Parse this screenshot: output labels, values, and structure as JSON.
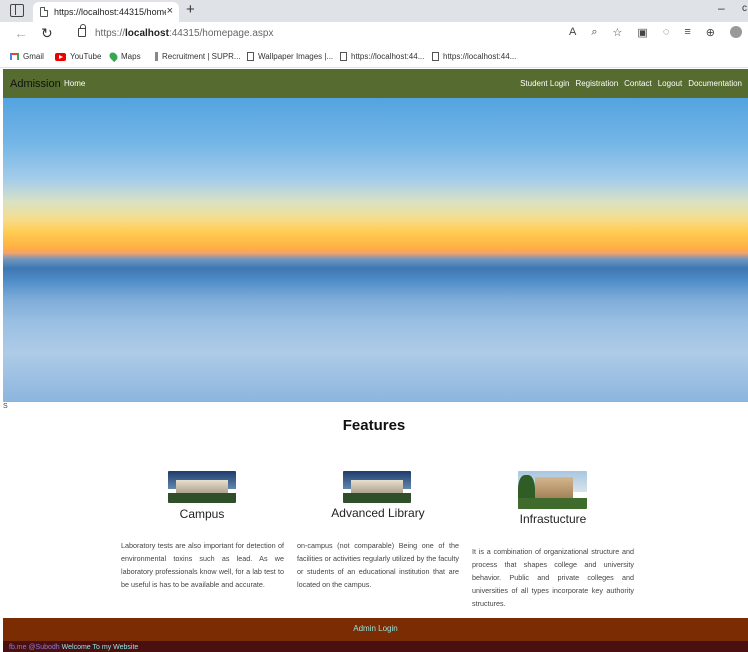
{
  "browser": {
    "tab_title": "https://localhost:44315/homepage.aspx",
    "tab_close": "×",
    "new_tab": "+",
    "window_minimize": "–",
    "url_prefix": "https://",
    "url_host": "localhost",
    "url_rest": ":44315/homepage.aspx",
    "back_icon": "←",
    "reload_icon": "↻",
    "bookmarks": [
      {
        "label": "Gmail",
        "icon": "gmail-icon"
      },
      {
        "label": "YouTube",
        "icon": "youtube-icon"
      },
      {
        "label": "Maps",
        "icon": "maps-icon"
      },
      {
        "label": "Recruitment | SUPR...",
        "icon": "recruitment-icon"
      },
      {
        "label": "Wallpaper Images |...",
        "icon": "page-icon"
      },
      {
        "label": "https://localhost:44...",
        "icon": "page-icon"
      },
      {
        "label": "https://localhost:44...",
        "icon": "page-icon"
      }
    ]
  },
  "navbar": {
    "brand": "Admission",
    "home": "Home",
    "links": [
      "Student Login",
      "Registration",
      "Contact",
      "Logout",
      "Documentation"
    ],
    "color": "#556b2f"
  },
  "hero": {
    "caption": "S"
  },
  "features": {
    "title": "Features",
    "items": [
      {
        "title": "Campus",
        "text": "Laboratory tests are also important for detection of environmental toxins such as lead. As we laboratory professionals know well, for a lab test to be useful is has to be available and accurate."
      },
      {
        "title": "Advanced Library",
        "text": "on-campus (not comparable) Being one of the facilities or activities regularly utilized by the faculty or students of an educational institution that are located on the campus."
      },
      {
        "title": "Infrastucture",
        "text": "It is a combination of organizational structure and process that shapes college and university behavior. Public and private colleges and universities of all types incorporate key authority structures."
      }
    ]
  },
  "footer": {
    "admin_login": "Admin Login",
    "credit_handle": "fb.me @Subodh",
    "welcome": "Welcome To my Website",
    "color": "#7c2c02"
  }
}
